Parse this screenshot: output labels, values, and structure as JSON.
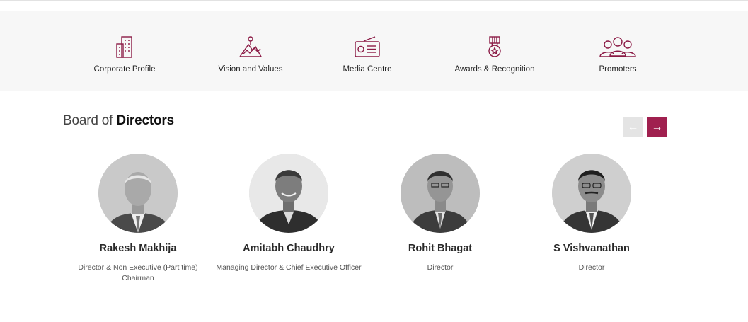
{
  "quick_links": [
    {
      "label": "Corporate Profile",
      "icon": "building-icon"
    },
    {
      "label": "Vision and Values",
      "icon": "mountain-peak-icon"
    },
    {
      "label": "Media Centre",
      "icon": "radio-icon"
    },
    {
      "label": "Awards & Recognition",
      "icon": "award-medal-icon"
    },
    {
      "label": "Promoters",
      "icon": "people-group-icon"
    }
  ],
  "board": {
    "title_light": "Board of ",
    "title_bold": "Directors",
    "prev_arrow": "←",
    "next_arrow": "→"
  },
  "directors": [
    {
      "name": "Rakesh Makhija",
      "role_line1": "Director & Non Executive (Part time)",
      "role_line2": "Chairman"
    },
    {
      "name": "Amitabh Chaudhry",
      "role_line1": "Managing Director & Chief Executive Officer",
      "role_line2": ""
    },
    {
      "name": "Rohit Bhagat",
      "role_line1": "Director",
      "role_line2": ""
    },
    {
      "name": "S Vishvanathan",
      "role_line1": "Director",
      "role_line2": ""
    }
  ],
  "colors": {
    "accent": "#a0204f",
    "icon_stroke": "#8b1a45",
    "band_bg": "#f7f7f7",
    "prev_button_bg": "#e4e4e4"
  }
}
